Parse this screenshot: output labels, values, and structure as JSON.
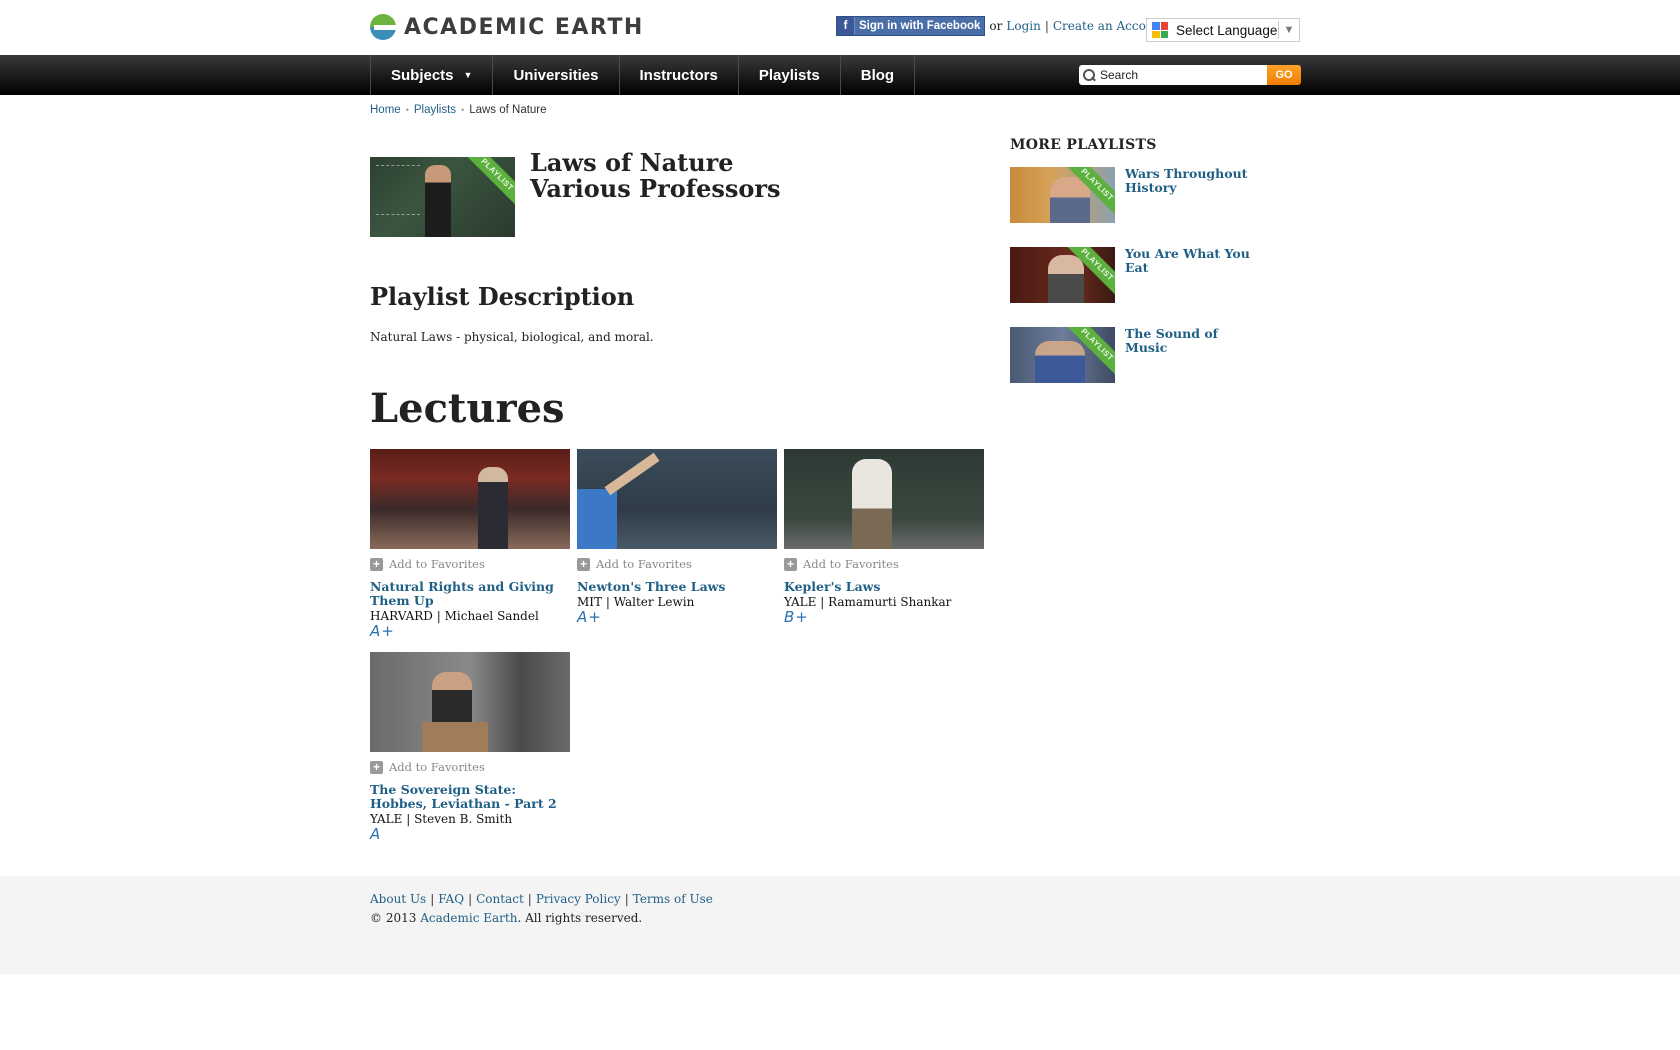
{
  "header": {
    "logo_text": "ACADEMIC EARTH",
    "facebook_button": "Sign in with Facebook",
    "or_text": "or",
    "login": "Login",
    "separator": "|",
    "create_account": "Create an Account",
    "language_select": "Select Language",
    "language_arrow": "▼"
  },
  "nav": {
    "items": [
      "Subjects",
      "Universities",
      "Instructors",
      "Playlists",
      "Blog"
    ],
    "subjects_caret": "▼",
    "search_placeholder": "Search",
    "search_button": "GO"
  },
  "breadcrumb": {
    "home": "Home",
    "playlists": "Playlists",
    "current": "Laws of Nature",
    "dot": "•"
  },
  "playlist": {
    "ribbon": "PLAYLIST",
    "title": "Laws of Nature",
    "author": "Various Professors",
    "description_heading": "Playlist Description",
    "description": "Natural Laws - physical, biological, and moral.",
    "lectures_heading": "Lectures"
  },
  "lectures": [
    {
      "fav": "Add to Favorites",
      "title": "Natural Rights and Giving Them Up",
      "school": "HARVARD",
      "instructor": "Michael Sandel",
      "grade": "A+"
    },
    {
      "fav": "Add to Favorites",
      "title": "Newton's Three Laws",
      "school": "MIT",
      "instructor": "Walter Lewin",
      "grade": "A+"
    },
    {
      "fav": "Add to Favorites",
      "title": "Kepler's Laws",
      "school": "YALE",
      "instructor": "Ramamurti Shankar",
      "grade": "B+"
    },
    {
      "fav": "Add to Favorites",
      "title": "The Sovereign State: Hobbes, Leviathan - Part 2",
      "school": "YALE",
      "instructor": "Steven B. Smith",
      "grade": "A"
    }
  ],
  "sidebar": {
    "heading": "MORE PLAYLISTS",
    "items": [
      {
        "title": "Wars Throughout History"
      },
      {
        "title": "You Are What You Eat"
      },
      {
        "title": "The Sound of Music"
      }
    ]
  },
  "footer": {
    "links": [
      "About Us",
      "FAQ",
      "Contact",
      "Privacy Policy",
      "Terms of Use"
    ],
    "copyright_prefix": "© 2013",
    "copyright_link": "Academic Earth",
    "copyright_suffix": ". All rights reserved."
  },
  "colors": {
    "link": "#1f5f86",
    "nav_bg": "#111111",
    "go_button": "#f58a07",
    "ribbon": "#5cb03e",
    "footer_bg": "#f4f4f4"
  }
}
